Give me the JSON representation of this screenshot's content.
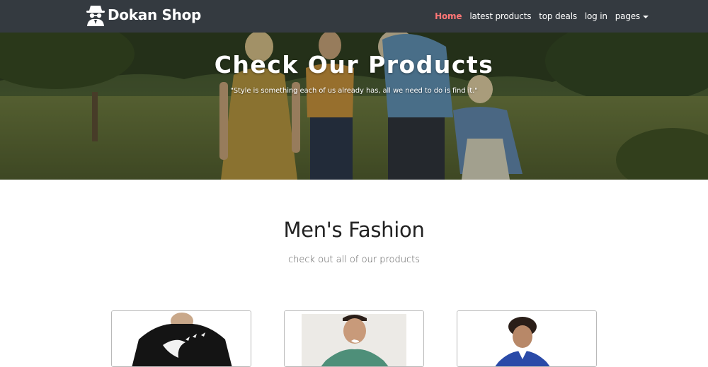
{
  "brand": {
    "name": "Dokan Shop",
    "icon": "spy-hat-icon"
  },
  "nav": {
    "items": [
      {
        "label": "Home",
        "active": true
      },
      {
        "label": "latest products",
        "active": false
      },
      {
        "label": "top deals",
        "active": false
      },
      {
        "label": "log in",
        "active": false
      }
    ],
    "dropdown_label": "pages"
  },
  "hero": {
    "title": "Check Our Products",
    "quote": "\"Style is something each of us already has, all we need to do is find it.\""
  },
  "section": {
    "title": "Men's Fashion",
    "subtitle": "check out all of our products"
  },
  "products": [
    {
      "image": "black-graphic-tshirt-photo"
    },
    {
      "image": "green-tshirt-smiling-man-photo"
    },
    {
      "image": "blue-shirt-man-photo"
    }
  ],
  "colors": {
    "navbar_bg": "#343a40",
    "active_link": "#ff7676",
    "text_dark": "#222222"
  }
}
